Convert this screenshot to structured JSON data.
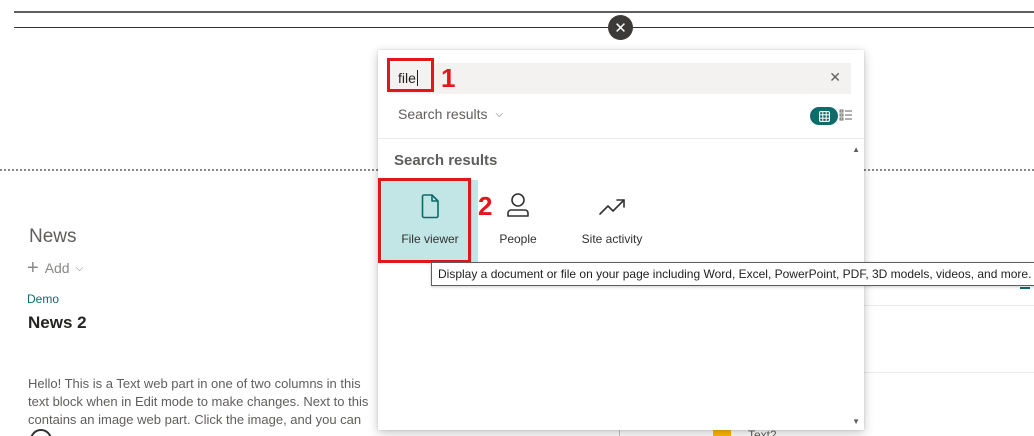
{
  "page": {
    "close_glyph": "✕",
    "news_title": "News",
    "add_label": "Add",
    "demo_label": "Demo",
    "news_item_title": "News 2",
    "body_lines": [
      "Hello! This is a Text web part in one of two columns in this",
      "text block when in Edit mode to make changes. Next to this",
      "contains an image web part. Click the image, and you can"
    ],
    "right_item_label": "Text2"
  },
  "toolbox": {
    "search": {
      "value": "file",
      "clear_glyph": "✕"
    },
    "annotation_1": "1",
    "annotation_2": "2",
    "results_filter": "Search results",
    "section_heading": "Search results",
    "tiles": [
      {
        "label": "File viewer",
        "icon": "document-icon",
        "selected": true
      },
      {
        "label": "People",
        "icon": "person-icon",
        "selected": false
      },
      {
        "label": "Site activity",
        "icon": "trending-icon",
        "selected": false
      }
    ],
    "tooltip": "Display a document or file on your page including Word, Excel, PowerPoint, PDF, 3D models, videos, and more."
  },
  "colors": {
    "accent": "#0f6a6a",
    "annotation_red": "#e3161c",
    "selected_tile": "#c2e5e6"
  }
}
